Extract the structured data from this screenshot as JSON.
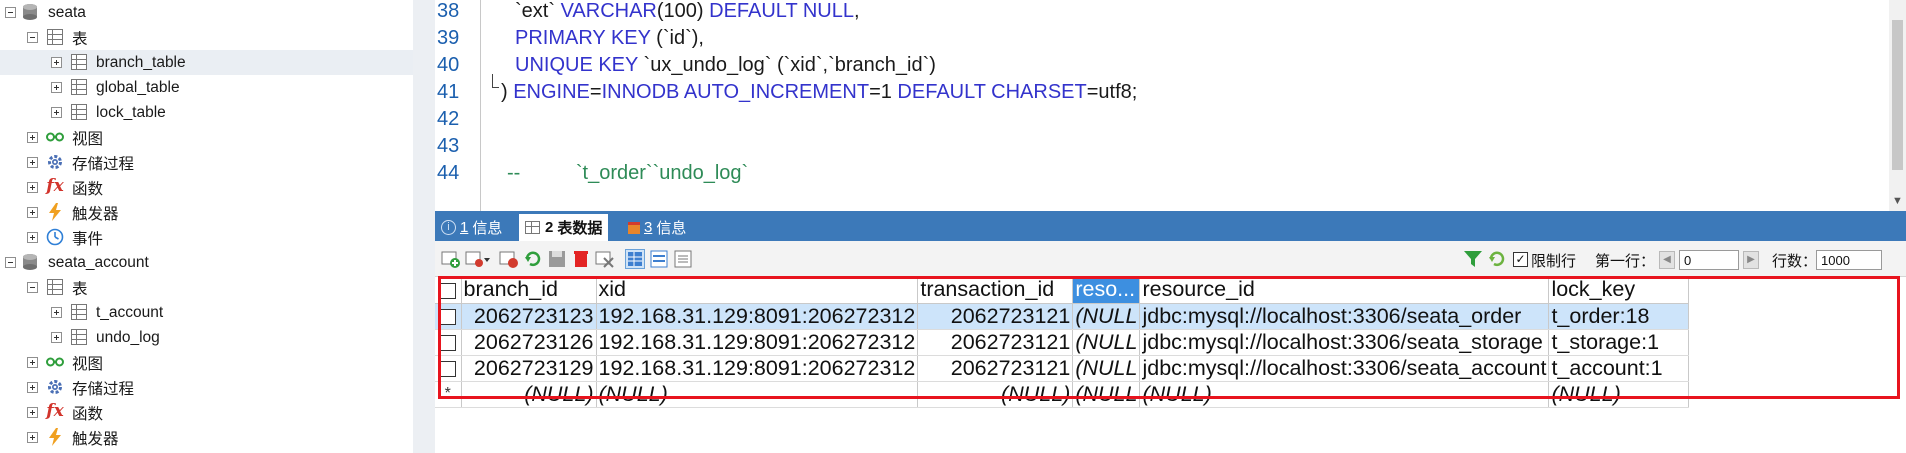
{
  "tree": {
    "nodes": [
      {
        "label": "seata",
        "type": "database"
      },
      {
        "label": "表",
        "type": "tables"
      },
      {
        "label": "branch_table",
        "type": "table"
      },
      {
        "label": "global_table",
        "type": "table"
      },
      {
        "label": "lock_table",
        "type": "table"
      },
      {
        "label": "视图",
        "type": "views"
      },
      {
        "label": "存储过程",
        "type": "procedures"
      },
      {
        "label": "函数",
        "type": "functions"
      },
      {
        "label": "触发器",
        "type": "triggers"
      },
      {
        "label": "事件",
        "type": "events"
      },
      {
        "label": "seata_account",
        "type": "database"
      },
      {
        "label": "表",
        "type": "tables"
      },
      {
        "label": "t_account",
        "type": "table"
      },
      {
        "label": "undo_log",
        "type": "table"
      },
      {
        "label": "视图",
        "type": "views"
      },
      {
        "label": "存储过程",
        "type": "procedures"
      },
      {
        "label": "函数",
        "type": "functions"
      },
      {
        "label": "触发器",
        "type": "triggers"
      }
    ],
    "function_icon_glyph": "fx"
  },
  "editor": {
    "line_numbers": [
      "38",
      "39",
      "40",
      "41",
      "42",
      "43",
      "44"
    ],
    "lines": {
      "l38": {
        "a": "`ext` ",
        "kw1": "VARCHAR",
        "b": "(100) ",
        "kw2": "DEFAULT NULL",
        "c": ","
      },
      "l39": {
        "kw1": "PRIMARY KEY",
        "b": " (`id`),"
      },
      "l40": {
        "kw1": "UNIQUE KEY",
        "b": " `ux_undo_log` (`xid`,`branch_id`)"
      },
      "l41": {
        "a": ") ",
        "kw1": "ENGINE",
        "b": "=",
        "kw2": "INNODB",
        "c": " ",
        "kw3": "AUTO_INCREMENT",
        "d": "=1 ",
        "kw4": "DEFAULT CHARSET",
        "e": "=utf8;"
      },
      "l44": {
        "comment": "--          `t_order``undo_log`"
      }
    }
  },
  "result_tabs": [
    {
      "num": "1",
      "label": "信息",
      "active": false
    },
    {
      "num": "2",
      "label": "表数据",
      "active": true
    },
    {
      "num": "3",
      "label": "信息",
      "active": false
    }
  ],
  "toolbar": {
    "limit_label": "限制行",
    "first_row_label": "第一行：",
    "first_row_value": "0",
    "rows_label": "行数：",
    "rows_value": "1000"
  },
  "grid": {
    "columns": [
      "branch_id",
      "xid",
      "transaction_id",
      "reso...",
      "resource_id",
      "lock_key"
    ],
    "rows": [
      [
        "2062723123",
        "192.168.31.129:8091:206272312",
        "2062723121",
        "(NULL",
        "jdbc:mysql://localhost:3306/seata_order",
        "t_order:18"
      ],
      [
        "2062723126",
        "192.168.31.129:8091:206272312",
        "2062723121",
        "(NULL",
        "jdbc:mysql://localhost:3306/seata_storage",
        "t_storage:1"
      ],
      [
        "2062723129",
        "192.168.31.129:8091:206272312",
        "2062723121",
        "(NULL",
        "jdbc:mysql://localhost:3306/seata_account",
        "t_account:1"
      ]
    ],
    "new_row_marker": "*",
    "new_row": [
      "(NULL)",
      "(NULL)",
      "(NULL)",
      "(NULL",
      "(NULL)",
      "(NULL)"
    ]
  },
  "colors": {
    "tab_bar": "#3c79b9",
    "keyword": "#3333cc",
    "comment": "#2e8b57",
    "line_number": "#1b5fae",
    "selected_row": "#cde4fa",
    "highlight_column": "#3d8fe0",
    "annotation_box": "#e8141e"
  }
}
